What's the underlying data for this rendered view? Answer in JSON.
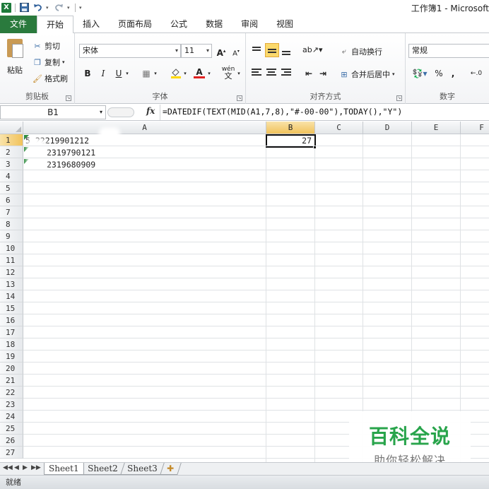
{
  "app": {
    "title": "工作簿1 - Microsoft",
    "quick_access": {
      "logo": "X",
      "save_icon": "save-icon",
      "undo_icon": "undo-icon",
      "redo_icon": "redo-icon",
      "customize_glyph": "▾"
    }
  },
  "ribbon": {
    "tabs": [
      {
        "label": "文件"
      },
      {
        "label": "开始"
      },
      {
        "label": "插入"
      },
      {
        "label": "页面布局"
      },
      {
        "label": "公式"
      },
      {
        "label": "数据"
      },
      {
        "label": "审阅"
      },
      {
        "label": "视图"
      }
    ],
    "active_tab": "开始",
    "clipboard": {
      "paste": "粘贴",
      "cut": "剪切",
      "copy": "复制",
      "format_painter": "格式刷",
      "group_label": "剪贴板"
    },
    "font": {
      "name": "宋体",
      "size": "11",
      "bold": "B",
      "italic": "I",
      "underline": "U",
      "group_label": "字体",
      "phonetic": "wén"
    },
    "alignment": {
      "wrap_text": "自动换行",
      "merge_center": "合并后居中",
      "group_label": "对齐方式"
    },
    "number": {
      "format": "常规",
      "percent": "%",
      "comma": ",",
      "group_label": "数字"
    }
  },
  "formula_bar": {
    "name_box": "B1",
    "fx_label": "fx",
    "formula": "=DATEDIF(TEXT(MID(A1,7,8),\"#-00-00\"),TODAY(),\"Y\")"
  },
  "sheet": {
    "columns": [
      "A",
      "B",
      "C",
      "D",
      "E",
      "F"
    ],
    "selected_column": "B",
    "rows": [
      "1",
      "2",
      "3",
      "4",
      "5",
      "6",
      "7",
      "8",
      "9",
      "10",
      "11",
      "12",
      "13",
      "14",
      "15",
      "16",
      "17",
      "18",
      "19",
      "20",
      "21",
      "22",
      "23",
      "24",
      "25",
      "26",
      "27"
    ],
    "selected_row": "1",
    "cells": {
      "A1": "5   22219901212",
      "A2": "2319790121",
      "A3": "2319680909",
      "B1": "27"
    },
    "active_cell": "B1"
  },
  "sheet_tabs": {
    "tabs": [
      "Sheet1",
      "Sheet2",
      "Sheet3"
    ],
    "active": "Sheet1",
    "nav": [
      "◀◀",
      "◀",
      "▶",
      "▶▶"
    ]
  },
  "status_bar": {
    "text": "就绪"
  },
  "watermark": {
    "title": "百科全说",
    "subtitle": "助你轻松解决"
  },
  "colors": {
    "file_tab": "#2a7a3d",
    "selection": "#f1c25b",
    "watermark_green": "#28a44b"
  }
}
